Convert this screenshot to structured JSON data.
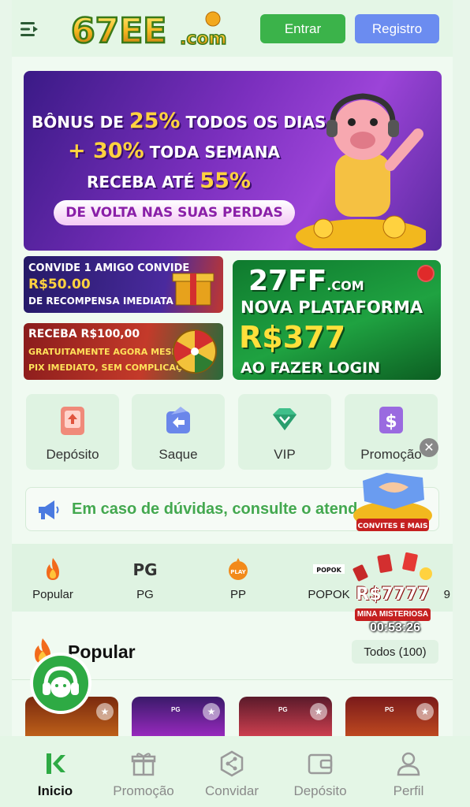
{
  "header": {
    "logo_text": "67EE.com",
    "login_label": "Entrar",
    "register_label": "Registro"
  },
  "banner_main": {
    "line1_prefix": "BÔNUS DE",
    "line1_value": "25%",
    "line1_suffix": "TODOS OS DIAS",
    "line2_value": "+ 30%",
    "line2_suffix": "TODA SEMANA",
    "line3_prefix": "RECEBA ATÉ",
    "line3_value": "55%",
    "pill": "DE VOLTA NAS SUAS PERDAS"
  },
  "banner_invite": {
    "line1": "CONVIDE 1 AMIGO CONVIDE",
    "amount": "R$50.00",
    "line3": "DE RECOMPENSA IMEDIATA"
  },
  "banner_receive": {
    "line1": "RECEBA R$100,00",
    "line2": "GRATUITAMENTE AGORA MESMO",
    "line3": "PIX IMEDIATO, SEM COMPLICAÇÕES."
  },
  "banner_platform": {
    "brand": "27FF",
    "brand_suffix": ".COM",
    "line2": "NOVA PLATAFORMA",
    "amount": "R$377",
    "line4": "AO FAZER LOGIN"
  },
  "quick_actions": [
    {
      "label": "Depósito"
    },
    {
      "label": "Saque"
    },
    {
      "label": "VIP"
    },
    {
      "label": "Promoção"
    }
  ],
  "notice": {
    "text": "Em caso de dúvidas, consulte o atend"
  },
  "promo_float": {
    "label": "CONVITES E MAIS"
  },
  "categories": [
    {
      "label": "Popular"
    },
    {
      "label": "PG"
    },
    {
      "label": "PP"
    },
    {
      "label": "POPOK"
    },
    {
      "label": "9"
    }
  ],
  "mystery": {
    "amount": "R$7777",
    "label": "MINA MISTERIOSA",
    "timer": "00:53:26"
  },
  "popular": {
    "title": "Popular",
    "all_label": "Todos",
    "count": "(100)"
  },
  "games": [
    {
      "tag": ""
    },
    {
      "tag": "PG"
    },
    {
      "tag": "PG"
    },
    {
      "tag": "PG"
    }
  ],
  "bottom_nav": [
    {
      "label": "Inicio",
      "active": true
    },
    {
      "label": "Promoção",
      "active": false
    },
    {
      "label": "Convidar",
      "active": false
    },
    {
      "label": "Depósito",
      "active": false
    },
    {
      "label": "Perfil",
      "active": false
    }
  ],
  "colors": {
    "accent": "#3bb34a",
    "register": "#6b8cf0",
    "background": "#e8f6ea"
  }
}
